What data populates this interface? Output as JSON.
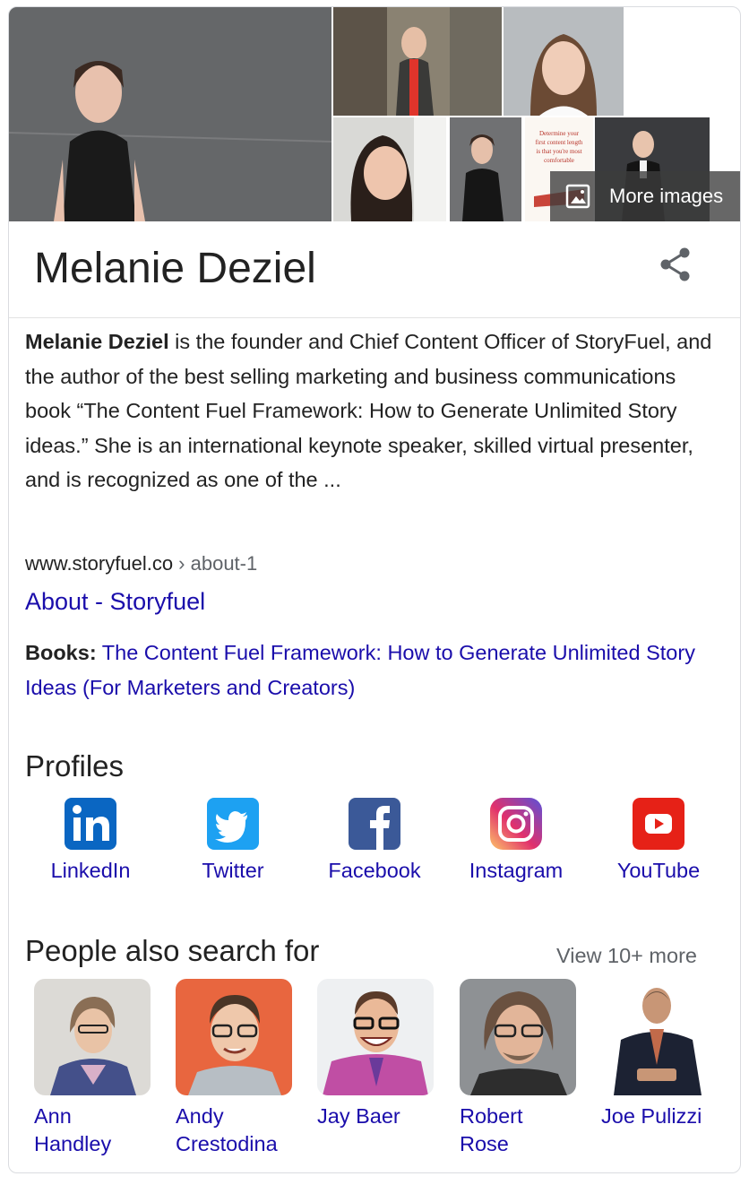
{
  "collage": {
    "more_images_label": "More images",
    "poster_text": [
      "Determine your",
      "first content length",
      "is that you're most",
      "comfortable"
    ]
  },
  "panel": {
    "title": "Melanie Deziel",
    "description": {
      "name_bold": "Melanie Deziel",
      "text": " is the founder and Chief Content Officer of StoryFuel, and the author of the best selling marketing and business communications book “The Content Fuel Framework: How to Generate Unlimited Story ideas.” She is an international keynote speaker, skilled virtual presenter, and is recognized as one of the ..."
    },
    "source": {
      "domain": "www.storyfuel.co",
      "path": " › about-1",
      "link_title": "About - Storyfuel"
    },
    "books": {
      "label": "Books:",
      "value": "The Content Fuel Framework: How to Generate Unlimited Story Ideas (For Marketers and Creators)"
    }
  },
  "profiles": {
    "heading": "Profiles",
    "items": [
      {
        "label": "LinkedIn",
        "icon": "linkedin-icon",
        "color": "#0a66c2"
      },
      {
        "label": "Twitter",
        "icon": "twitter-icon",
        "color": "#1da1f2"
      },
      {
        "label": "Facebook",
        "icon": "facebook-icon",
        "color": "#3b5998"
      },
      {
        "label": "Instagram",
        "icon": "instagram-icon",
        "color": "#c13584"
      },
      {
        "label": "YouTube",
        "icon": "youtube-icon",
        "color": "#e62117"
      }
    ]
  },
  "people": {
    "heading": "People also search for",
    "view_more": "View 10+ more",
    "items": [
      {
        "line1": "Ann",
        "line2": "Handley"
      },
      {
        "line1": "Andy",
        "line2": "Crestodina"
      },
      {
        "line1": "Jay Baer",
        "line2": ""
      },
      {
        "line1": "Robert",
        "line2": "Rose"
      },
      {
        "line1": "Joe Pulizzi",
        "line2": ""
      }
    ]
  }
}
